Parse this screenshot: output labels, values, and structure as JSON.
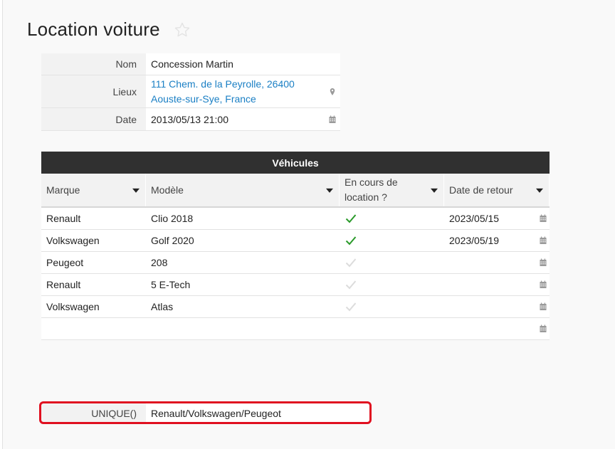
{
  "page": {
    "title": "Location voiture"
  },
  "form": {
    "nom_label": "Nom",
    "nom_value": "Concession Martin",
    "lieux_label": "Lieux",
    "lieux_line1": "111 Chem. de la Peyrolle, 26400",
    "lieux_line2": "Aouste-sur-Sye, France",
    "date_label": "Date",
    "date_value": "2013/05/13 21:00"
  },
  "table": {
    "title": "Véhicules",
    "headers": {
      "marque": "Marque",
      "modele": "Modèle",
      "encours_line1": "En cours de",
      "encours_line2": "location ?",
      "retour": "Date de retour"
    },
    "rows": [
      {
        "marque": "Renault",
        "modele": "Clio 2018",
        "en_cours": true,
        "retour": "2023/05/15"
      },
      {
        "marque": "Volkswagen",
        "modele": "Golf 2020",
        "en_cours": true,
        "retour": "2023/05/19"
      },
      {
        "marque": "Peugeot",
        "modele": "208",
        "en_cours": false,
        "retour": ""
      },
      {
        "marque": "Renault",
        "modele": "5 E-Tech",
        "en_cours": false,
        "retour": ""
      },
      {
        "marque": "Volkswagen",
        "modele": "Atlas",
        "en_cours": false,
        "retour": ""
      }
    ]
  },
  "formula": {
    "label": "UNIQUE()",
    "value": "Renault/Volkswagen/Peugeot"
  },
  "icons": {
    "favorite": "star-outline-icon",
    "location": "map-pin-icon",
    "date": "calendar-icon",
    "checked": "check-icon",
    "unchecked": "check-icon-faded",
    "sort": "caret-down-icon"
  },
  "colors": {
    "link": "#1a7fc4",
    "check_on": "#2a9a2a",
    "check_off": "#dcdcdc",
    "table_header": "#303030",
    "highlight": "#e01020"
  }
}
